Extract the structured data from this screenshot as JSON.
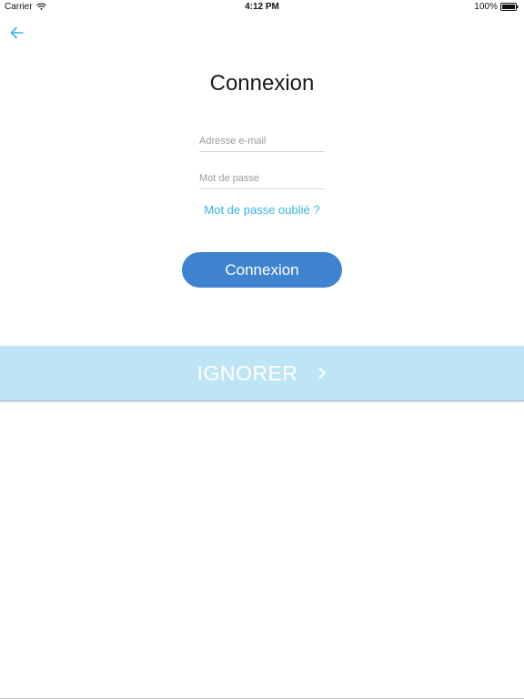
{
  "status_bar": {
    "carrier": "Carrier",
    "time": "4:12 PM",
    "battery": "100%"
  },
  "header": {
    "back_icon": "arrow-left-icon"
  },
  "login": {
    "title": "Connexion",
    "email_placeholder": "Adresse e-mail",
    "email_value": "",
    "password_placeholder": "Mot de passe",
    "password_value": "",
    "forgot_label": "Mot de passe oublié ?",
    "submit_label": "Connexion"
  },
  "skip": {
    "label": "IGNORER",
    "icon": "chevron-right-icon"
  },
  "colors": {
    "accent_blue": "#3f83cf",
    "link_blue": "#35b4e5",
    "skip_bg": "#bee5f5",
    "back_arrow": "#35b4e5"
  }
}
